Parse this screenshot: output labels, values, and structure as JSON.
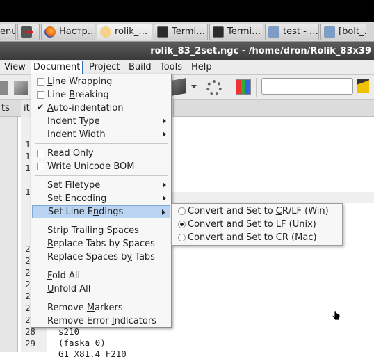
{
  "taskbar": {
    "items": [
      {
        "label": "enu",
        "icon": "menu-icon"
      },
      {
        "label": "",
        "icon": "logout-icon"
      },
      {
        "label": "Настр…",
        "icon": "firefox-icon"
      },
      {
        "label": "rolik_…",
        "icon": "geany-icon"
      },
      {
        "label": "Termi…",
        "icon": "terminal-icon"
      },
      {
        "label": "Termi…",
        "icon": "terminal-icon"
      },
      {
        "label": "test - …",
        "icon": "folder-icon"
      },
      {
        "label": "[bolt_…",
        "icon": "folder-icon"
      }
    ]
  },
  "window": {
    "title": "rolik_83_2set.ngc - /home/dron/Rolik_83x39"
  },
  "menubar": {
    "items": [
      "View",
      "Document",
      "Project",
      "Build",
      "Tools",
      "Help"
    ]
  },
  "tabs": {
    "left": "ts",
    "right": "it"
  },
  "document_menu": {
    "items": [
      {
        "pre": "",
        "u": "L",
        "post": "ine Wrapping",
        "check": "off"
      },
      {
        "pre": "Line ",
        "u": "B",
        "post": "reaking",
        "check": "off"
      },
      {
        "pre": "",
        "u": "A",
        "post": "uto-indentation",
        "check": "on"
      },
      {
        "pre": "In",
        "u": "d",
        "post": "ent Type",
        "submenu": true
      },
      {
        "pre": "Indent Widt",
        "u": "h",
        "post": "",
        "submenu": true
      },
      {
        "pre": "Read ",
        "u": "O",
        "post": "nly",
        "check": "off"
      },
      {
        "pre": "",
        "u": "W",
        "post": "rite Unicode BOM",
        "check": "off"
      },
      {
        "pre": "Set File",
        "u": "t",
        "post": "ype",
        "submenu": true
      },
      {
        "pre": "Set ",
        "u": "E",
        "post": "ncoding",
        "submenu": true
      },
      {
        "pre": "Set Line E",
        "u": "n",
        "post": "dings",
        "submenu": true,
        "highlighted": true
      },
      {
        "pre": "",
        "u": "S",
        "post": "trip Trailing Spaces"
      },
      {
        "pre": "",
        "u": "R",
        "post": "eplace Tabs by Spaces"
      },
      {
        "pre": "Replace Spaces b",
        "u": "y",
        "post": " Tabs"
      },
      {
        "pre": "",
        "u": "F",
        "post": "old All"
      },
      {
        "pre": "",
        "u": "U",
        "post": "nfold All"
      },
      {
        "pre": "Remove ",
        "u": "M",
        "post": "arkers"
      },
      {
        "pre": "Remove Error ",
        "u": "I",
        "post": "ndicators"
      }
    ]
  },
  "line_endings_menu": {
    "items": [
      {
        "pre": "Convert and Set to ",
        "u": "C",
        "post": "R/LF (Win)",
        "selected": false
      },
      {
        "pre": "Convert and Set to ",
        "u": "L",
        "post": "F (Unix)",
        "selected": true
      },
      {
        "pre": "Convert and Set to CR (",
        "u": "M",
        "post": "ac)",
        "selected": false
      }
    ]
  },
  "editor": {
    "line_numbers": [
      "1",
      "1",
      "1",
      "1",
      "2",
      "2",
      "2",
      "2",
      "2",
      "2",
      "2",
      "28",
      "29"
    ],
    "code_lines": [
      "s210",
      "(faska 0)",
      "G1 X81.4 F210"
    ]
  },
  "colors": {
    "highlight": "#b9d3f0",
    "titlebar": "#3a3a3a"
  }
}
